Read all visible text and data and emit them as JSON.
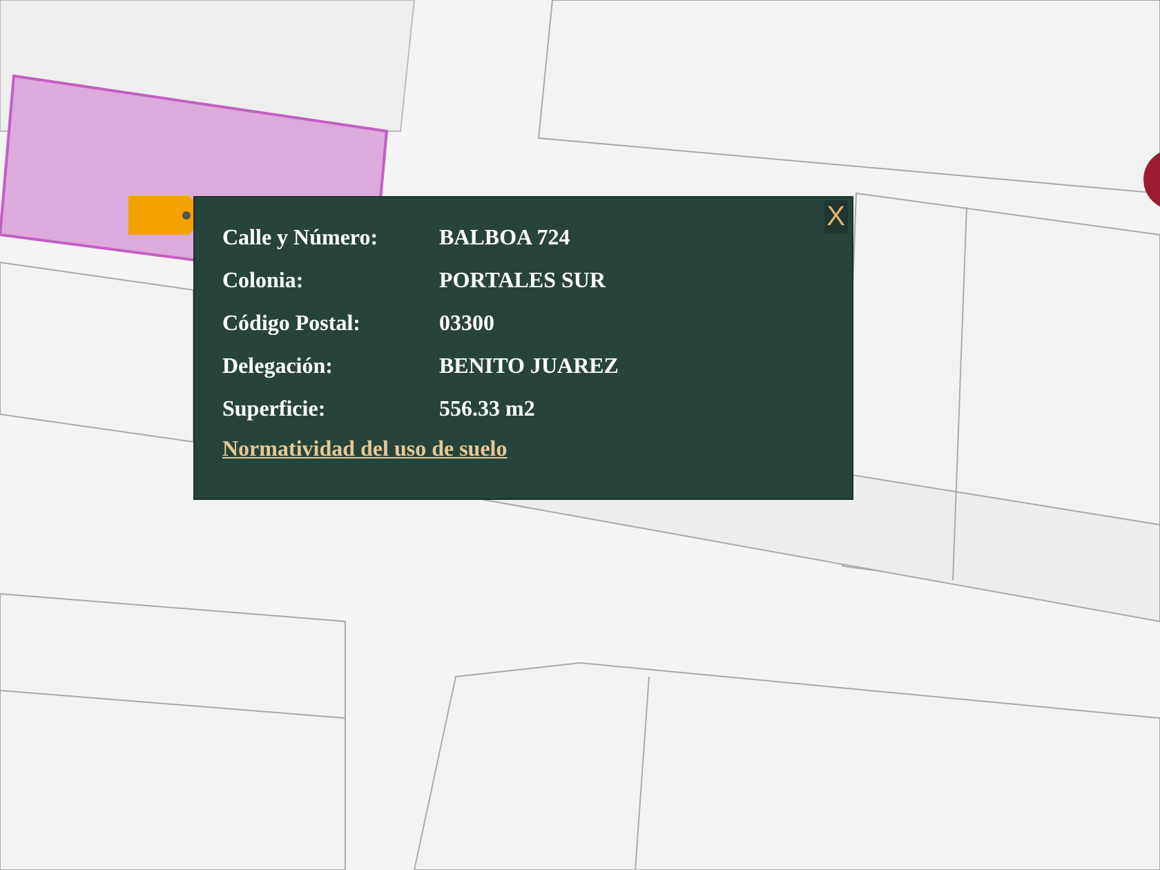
{
  "popup": {
    "close": "X",
    "fields": [
      {
        "label": "Calle y Número:",
        "value": "BALBOA 724"
      },
      {
        "label": "Colonia:",
        "value": "PORTALES SUR"
      },
      {
        "label": "Código Postal:",
        "value": "03300"
      },
      {
        "label": "Delegación:",
        "value": "BENITO JUAREZ"
      },
      {
        "label": "Superficie:",
        "value": "556.33 m2"
      }
    ],
    "link": "Normatividad del uso de suelo"
  }
}
